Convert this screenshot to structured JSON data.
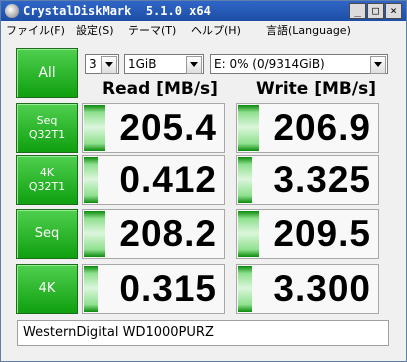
{
  "window": {
    "title": "CrystalDiskMark  5.1.0 x64",
    "controls": {
      "minimize": "_",
      "maximize": "□",
      "close": "×"
    }
  },
  "menu": [
    {
      "label": "ファイル(F)"
    },
    {
      "label": "設定(S)"
    },
    {
      "label": "テーマ(T)"
    },
    {
      "label": "ヘルプ(H)"
    },
    {
      "label": "言語(Language)"
    }
  ],
  "controls": {
    "all_label": "All",
    "count_value": "3",
    "size_value": "1GiB",
    "drive_value": "E: 0% (0/9314GiB)"
  },
  "columns": {
    "read": "Read [MB/s]",
    "write": "Write [MB/s]"
  },
  "rows": [
    {
      "line1": "Seq",
      "line2": "Q32T1",
      "read": "205.4",
      "write": "206.9"
    },
    {
      "line1": "4K",
      "line2": "Q32T1",
      "read": "0.412",
      "write": "3.325"
    },
    {
      "line1": "Seq",
      "line2": "",
      "read": "208.2",
      "write": "209.5"
    },
    {
      "line1": "4K",
      "line2": "",
      "read": "0.315",
      "write": "3.300"
    }
  ],
  "status": "WesternDigital WD1000PURZ",
  "colors": {
    "button_green": "#1db51d",
    "title_blue": "#2557b8",
    "bar_green": "#0a8a0a"
  },
  "icons": [
    "app-icon",
    "chevron-down-icon",
    "minimize-icon",
    "maximize-icon",
    "close-icon"
  ]
}
